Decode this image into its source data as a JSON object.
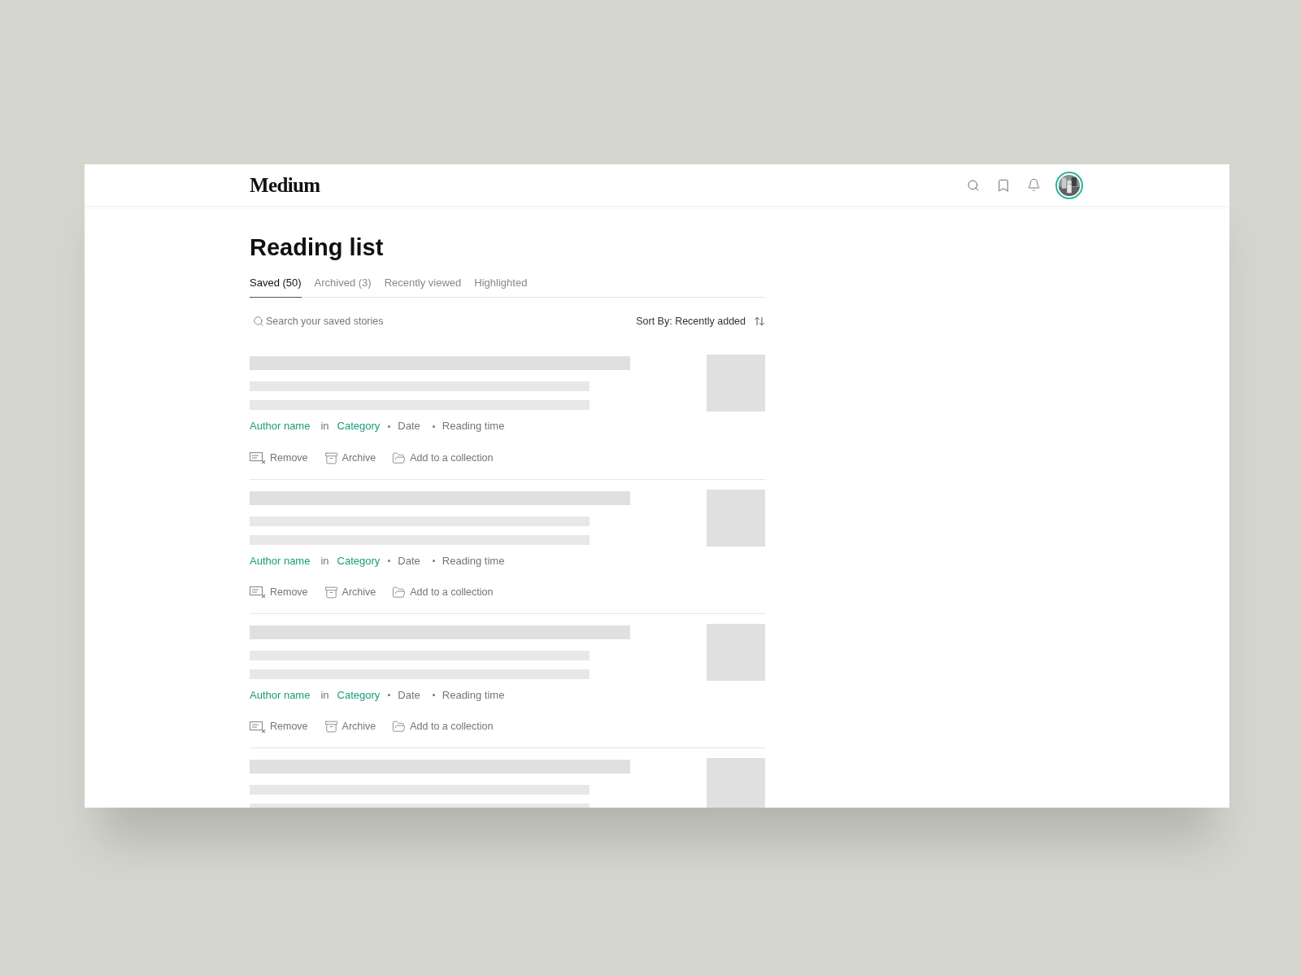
{
  "header": {
    "logo": "Medium"
  },
  "page": {
    "title": "Reading list"
  },
  "tabs": [
    {
      "label": "Saved (50)",
      "selected": true
    },
    {
      "label": "Archived (3)",
      "selected": false
    },
    {
      "label": "Recently viewed",
      "selected": false
    },
    {
      "label": "Highlighted",
      "selected": false
    }
  ],
  "search": {
    "placeholder": "Search your saved stories"
  },
  "sort": {
    "label": "Sort By: Recently added"
  },
  "stories": [
    {
      "author": "Author name",
      "in": "in",
      "category": "Category",
      "date": "Date",
      "reading_time": "Reading time",
      "actions": [
        "Remove",
        "Archive",
        "Add to a collection"
      ]
    },
    {
      "author": "Author name",
      "in": "in",
      "category": "Category",
      "date": "Date",
      "reading_time": "Reading time",
      "actions": [
        "Remove",
        "Archive",
        "Add to a collection"
      ]
    },
    {
      "author": "Author name",
      "in": "in",
      "category": "Category",
      "date": "Date",
      "reading_time": "Reading time",
      "actions": [
        "Remove",
        "Archive",
        "Add to a collection"
      ]
    }
  ]
}
